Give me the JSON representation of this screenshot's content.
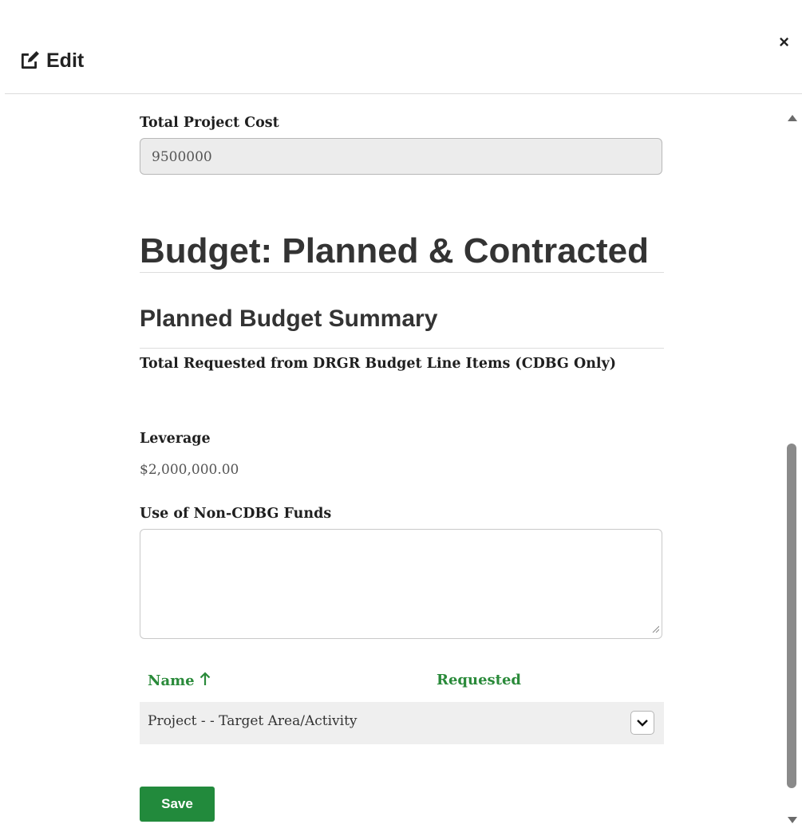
{
  "header": {
    "title": "Edit",
    "edit_icon": "edit-square-pencil-icon",
    "close_label": "×"
  },
  "fields": {
    "total_project_cost_label": "Total Project Cost",
    "total_project_cost_value": "9500000"
  },
  "budget": {
    "section_title": "Budget: Planned & Contracted",
    "planned_summary_title": "Planned Budget Summary",
    "total_requested_label": "Total Requested from DRGR Budget Line Items (CDBG Only)",
    "leverage_label": "Leverage",
    "leverage_value": "$2,000,000.00",
    "non_cdbg_label": "Use of Non-CDBG Funds",
    "non_cdbg_value": ""
  },
  "table": {
    "columns": [
      {
        "label": "Name",
        "sort": "ascending"
      },
      {
        "label": "Requested"
      }
    ],
    "rows": [
      {
        "name": "Project - - Target Area/Activity",
        "requested": ""
      }
    ]
  },
  "actions": {
    "save_label": "Save"
  },
  "scroll": {
    "position_fraction": 0.93
  },
  "colors": {
    "accent_green": "#228a3c",
    "header_green_text": "#2a8a3a"
  }
}
